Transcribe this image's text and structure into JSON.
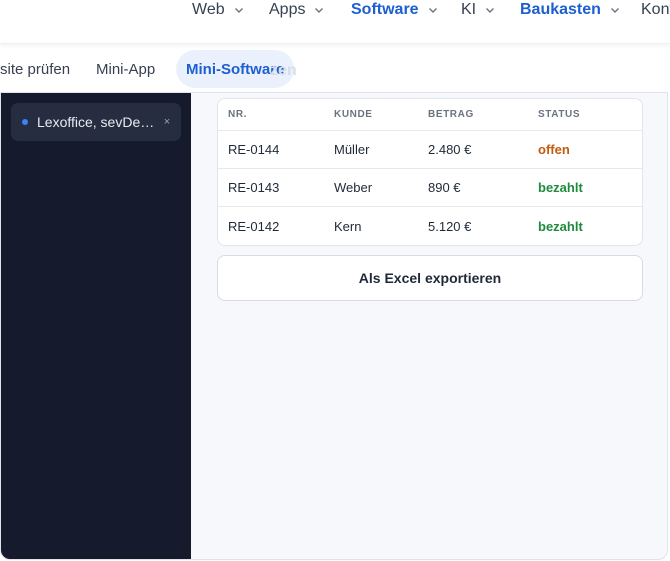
{
  "nav": {
    "items": [
      {
        "label": "Web",
        "has_dropdown": true,
        "active": false
      },
      {
        "label": "Apps",
        "has_dropdown": true,
        "active": false
      },
      {
        "label": "Software",
        "has_dropdown": true,
        "active": true
      },
      {
        "label": "KI",
        "has_dropdown": true,
        "active": false
      },
      {
        "label": "Baukasten",
        "has_dropdown": true,
        "active": true
      },
      {
        "label": "Kont",
        "has_dropdown": false,
        "active": false
      }
    ]
  },
  "subtabs": {
    "items": [
      {
        "label": "site prüfen",
        "active": false
      },
      {
        "label": "Mini-App",
        "active": false
      },
      {
        "label": "Mini-Software",
        "active": true
      }
    ],
    "ghost_label": "zen"
  },
  "sidebar": {
    "chat": {
      "label": "Lexoffice, sevDesk …",
      "close": "×"
    }
  },
  "invoices": {
    "columns": [
      "NR.",
      "KUNDE",
      "BETRAG",
      "STATUS"
    ],
    "rows": [
      {
        "nr": "RE-0144",
        "kunde": "Müller",
        "betrag": "2.480 €",
        "status": "offen"
      },
      {
        "nr": "RE-0143",
        "kunde": "Weber",
        "betrag": "890 €",
        "status": "bezahlt"
      },
      {
        "nr": "RE-0142",
        "kunde": "Kern",
        "betrag": "5.120 €",
        "status": "bezahlt"
      }
    ]
  },
  "export_button": {
    "label": "Als Excel exportieren"
  },
  "colors": {
    "accent": "#1d5fd1",
    "sidebar_bg": "#151b2c",
    "status_open": "#c25a10",
    "status_paid": "#1f8a3c"
  }
}
